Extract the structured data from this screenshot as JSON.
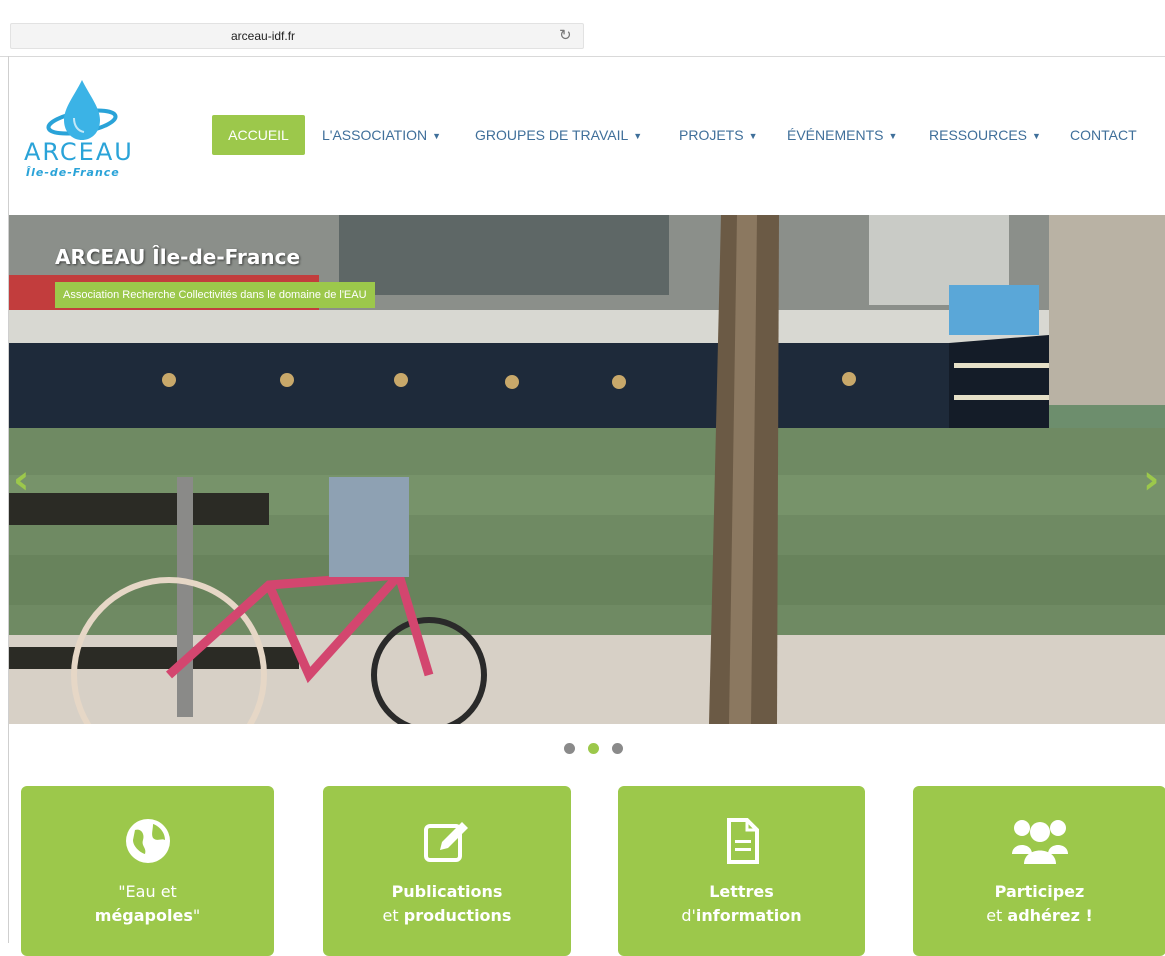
{
  "browser": {
    "url": "arceau-idf.fr",
    "reload_icon": "reload-icon"
  },
  "logo": {
    "name": "ARCEAU",
    "subtitle": "Île-de-France",
    "icon": "water-drop-icon"
  },
  "nav": {
    "items": [
      {
        "label": "ACCUEIL",
        "active": true,
        "dropdown": false
      },
      {
        "label": "L'ASSOCIATION",
        "dropdown": true
      },
      {
        "label": "GROUPES DE TRAVAIL",
        "dropdown": true
      },
      {
        "label": "PROJETS",
        "dropdown": true
      },
      {
        "label": "ÉVÉNEMENTS",
        "dropdown": true
      },
      {
        "label": "RESSOURCES",
        "dropdown": true
      },
      {
        "label": "CONTACT",
        "dropdown": false
      }
    ],
    "caret": "▼"
  },
  "slider": {
    "title": "ARCEAU Île-de-France",
    "subtitle": "Association Recherche Collectivités dans le domaine de l'EAU",
    "prev": "‹",
    "next": "›",
    "active_slide": 2,
    "slide_count": 3
  },
  "features": [
    {
      "icon": "globe-icon",
      "line1": "\"Eau et",
      "line2_bold": "mégapoles",
      "line2_rest": "\""
    },
    {
      "icon": "edit-icon",
      "line1": "Publications",
      "line2_pre": "et ",
      "line2_bold": "productions"
    },
    {
      "icon": "document-icon",
      "line1": "Lettres",
      "line2_pre": "d'",
      "line2_bold": "information"
    },
    {
      "icon": "users-icon",
      "line1": "Participez",
      "line2_pre": "et ",
      "line2_bold": "adhérez !"
    }
  ],
  "colors": {
    "accent": "#9cc84b",
    "nav_text": "#3f6f9a",
    "logo_blue": "#2aa3d8"
  }
}
